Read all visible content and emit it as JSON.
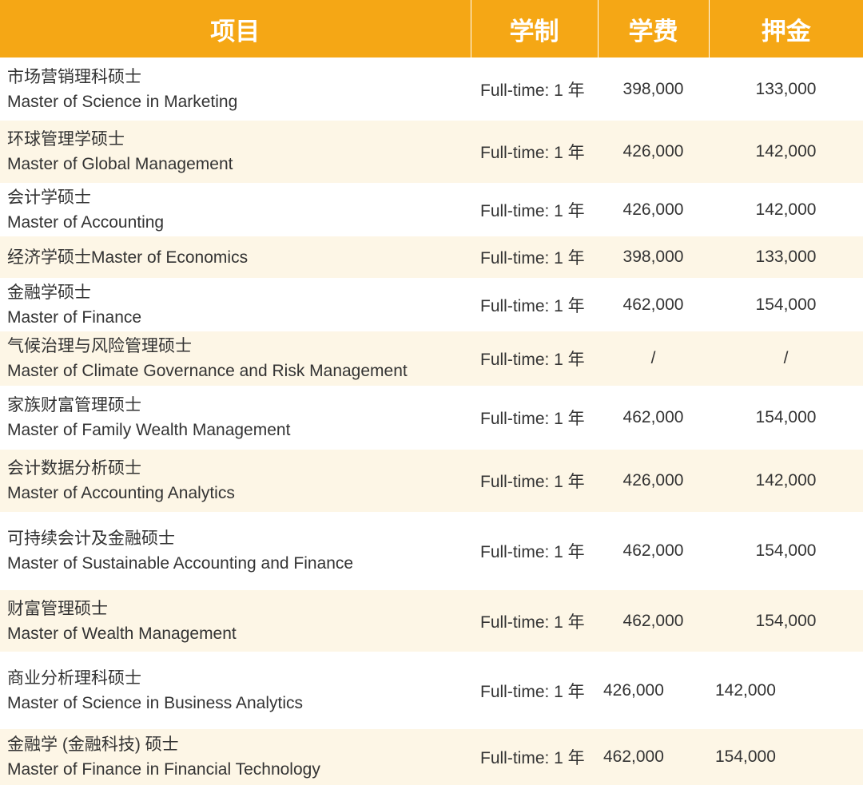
{
  "headers": {
    "program": "项目",
    "duration": "学制",
    "tuition": "学费",
    "deposit": "押金"
  },
  "rows": [
    {
      "cn": "市场营销理科硕士",
      "en": "Master of Science in Marketing",
      "duration": "Full-time: 1 年",
      "tuition": "398,000",
      "deposit": "133,000"
    },
    {
      "cn": "环球管理学硕士",
      "en": "Master of Global Management",
      "duration": "Full-time: 1 年",
      "tuition": "426,000",
      "deposit": "142,000"
    },
    {
      "cn": "会计学硕士",
      "en": "Master of Accounting",
      "duration": "Full-time: 1 年",
      "tuition": "426,000",
      "deposit": "142,000"
    },
    {
      "cn": "经济学硕士Master of Economics",
      "en": "",
      "duration": "Full-time: 1 年",
      "tuition": "398,000",
      "deposit": "133,000"
    },
    {
      "cn": "金融学硕士",
      "en": "Master of Finance",
      "duration": "Full-time: 1 年",
      "tuition": "462,000",
      "deposit": "154,000"
    },
    {
      "cn": "气候治理与风险管理硕士",
      "en": "Master of Climate Governance and Risk Management",
      "duration": "Full-time: 1 年",
      "tuition": "/",
      "deposit": "/"
    },
    {
      "cn": "家族财富管理硕士",
      "en": "Master of Family Wealth Management",
      "duration": "Full-time: 1 年",
      "tuition": "462,000",
      "deposit": "154,000"
    },
    {
      "cn": "会计数据分析硕士",
      "en": "Master of Accounting Analytics",
      "duration": "Full-time: 1 年",
      "tuition": "426,000",
      "deposit": "142,000"
    },
    {
      "cn": "可持续会计及金融硕士",
      "en": "Master of Sustainable Accounting and Finance",
      "duration": "Full-time: 1 年",
      "tuition": "462,000",
      "deposit": "154,000"
    },
    {
      "cn": "财富管理硕士",
      "en": "Master of Wealth Management",
      "duration": "Full-time: 1 年",
      "tuition": "462,000",
      "deposit": "154,000"
    },
    {
      "cn": "商业分析理科硕士",
      "en": "Master of Science in Business Analytics",
      "duration": "Full-time: 1 年",
      "tuition": "426,000",
      "deposit": "142,000"
    },
    {
      "cn": "金融学 (金融科技) 硕士",
      "en": "Master of Finance in Financial Technology",
      "duration": "Full-time: 1 年",
      "tuition": "462,000",
      "deposit": "154,000"
    }
  ],
  "colors": {
    "header_bg": "#f5a715",
    "header_text": "#ffffff",
    "stripe_bg": "#fdf6e6",
    "body_text": "#333333"
  }
}
